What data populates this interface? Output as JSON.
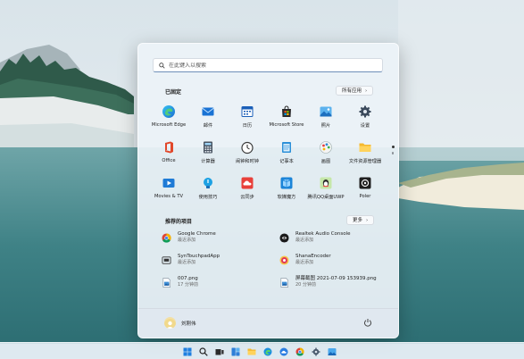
{
  "search": {
    "placeholder": "在此键入以搜索"
  },
  "pinned": {
    "title": "已固定",
    "all_apps_label": "所有应用",
    "apps": [
      {
        "label": "Microsoft Edge",
        "icon": "edge-icon"
      },
      {
        "label": "邮件",
        "icon": "mail-icon"
      },
      {
        "label": "日历",
        "icon": "calendar-icon"
      },
      {
        "label": "Microsoft Store",
        "icon": "store-icon"
      },
      {
        "label": "照片",
        "icon": "photos-icon"
      },
      {
        "label": "设置",
        "icon": "settings-icon"
      },
      {
        "label": "Office",
        "icon": "office-icon"
      },
      {
        "label": "计算器",
        "icon": "calculator-icon"
      },
      {
        "label": "闹钟和时钟",
        "icon": "alarm-clock-icon"
      },
      {
        "label": "记事本",
        "icon": "notepad-icon"
      },
      {
        "label": "画图",
        "icon": "paint-icon"
      },
      {
        "label": "文件资源管理器",
        "icon": "file-explorer-icon"
      },
      {
        "label": "Movies & TV",
        "icon": "movies-tv-icon"
      },
      {
        "label": "使用技巧",
        "icon": "tips-icon"
      },
      {
        "label": "云同步",
        "icon": "cloud-sync-icon"
      },
      {
        "label": "软媒魔方",
        "icon": "ruanmei-cube-icon"
      },
      {
        "label": "腾讯QQ桌面UWP",
        "icon": "qq-uwp-icon"
      },
      {
        "label": "Poler",
        "icon": "poler-icon"
      }
    ]
  },
  "recommended": {
    "title": "推荐的项目",
    "more_label": "更多",
    "items": [
      {
        "name": "Google Chrome",
        "sub": "最近添加",
        "icon": "chrome-icon"
      },
      {
        "name": "Realtek Audio Console",
        "sub": "最近添加",
        "icon": "realtek-audio-icon"
      },
      {
        "name": "SynTouchpadApp",
        "sub": "最近添加",
        "icon": "touchpad-icon"
      },
      {
        "name": "ShanaEncoder",
        "sub": "最近添加",
        "icon": "shana-encoder-icon"
      },
      {
        "name": "007.png",
        "sub": "17 分钟前",
        "icon": "image-file-icon"
      },
      {
        "name": "屏幕截图 2021-07-09 153939.png",
        "sub": "20 分钟前",
        "icon": "image-file-icon"
      }
    ]
  },
  "user": {
    "name": "刘刚伟"
  },
  "taskbar": {
    "icons": [
      "windows-start-icon",
      "search-icon",
      "task-view-icon",
      "widgets-icon",
      "file-explorer-icon",
      "edge-icon",
      "cloud-icon",
      "chrome-icon",
      "settings-icon",
      "photos-icon"
    ]
  }
}
